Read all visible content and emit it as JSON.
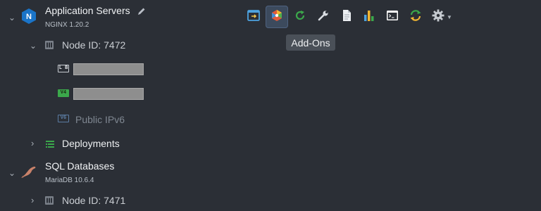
{
  "app_servers": {
    "title": "Application Servers",
    "version": "NGINX 1.20.2",
    "node_label": "Node ID: 7472",
    "ipv4_tag": "V4",
    "ipv6_tag": "V6",
    "lb_tag": "L B",
    "public_ipv6": "Public IPv6",
    "deployments": "Deployments"
  },
  "sql_db": {
    "title": "SQL Databases",
    "version": "MariaDB 10.6.4",
    "node_label": "Node ID: 7471"
  },
  "toolbar": {
    "tooltip": "Add-Ons",
    "buttons": [
      "open-in-browser-icon",
      "add-ons-icon",
      "restart-icon",
      "config-icon",
      "log-icon",
      "statistics-icon",
      "web-ssh-icon",
      "redeploy-icon",
      "settings-icon"
    ]
  },
  "colors": {
    "background": "#2b2f36",
    "accent_active": "#3c4a5d",
    "green": "#3ba84b",
    "nginx_blue": "#1a74c8"
  }
}
